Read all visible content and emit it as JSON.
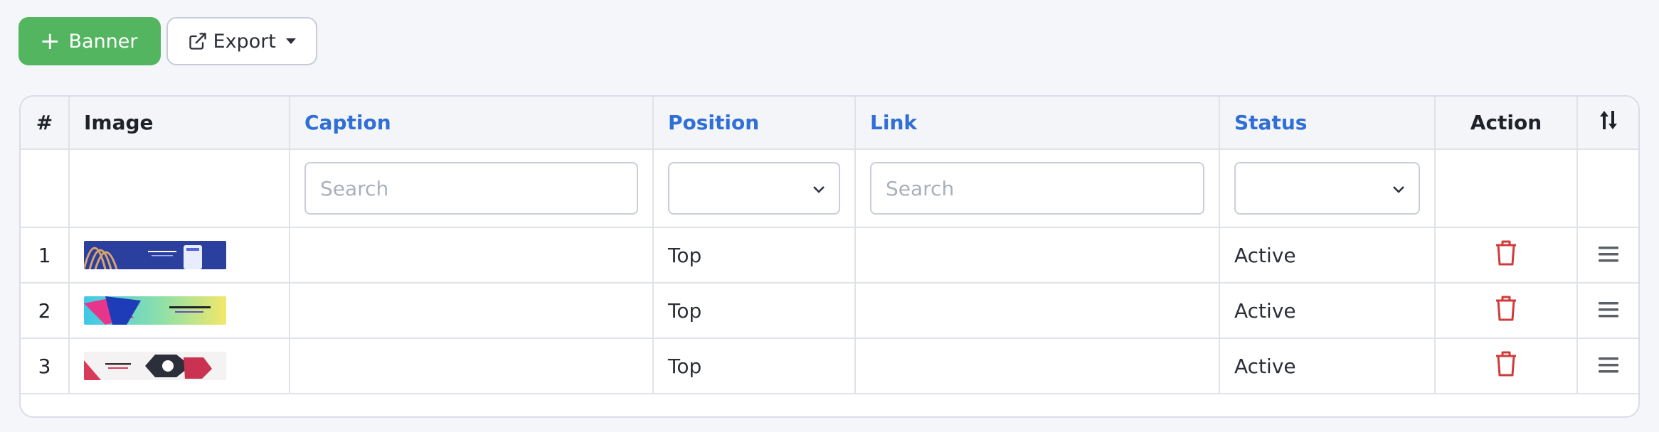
{
  "toolbar": {
    "add_label": "Banner",
    "export_label": "Export"
  },
  "table": {
    "headers": {
      "index": "#",
      "image": "Image",
      "caption": "Caption",
      "position": "Position",
      "link": "Link",
      "status": "Status",
      "action": "Action"
    },
    "filters": {
      "caption_placeholder": "Search",
      "link_placeholder": "Search",
      "position_value": "",
      "status_value": ""
    },
    "rows": [
      {
        "index": "1",
        "caption": "",
        "position": "Top",
        "link": "",
        "status": "Active"
      },
      {
        "index": "2",
        "caption": "",
        "position": "Top",
        "link": "",
        "status": "Active"
      },
      {
        "index": "3",
        "caption": "",
        "position": "Top",
        "link": "",
        "status": "Active"
      }
    ]
  },
  "colors": {
    "primary": "#53b560",
    "sortable_header": "#2f6fd6",
    "delete_icon": "#cf3b3b"
  },
  "icons": {
    "add": "plus-icon",
    "export": "external-link-icon",
    "sort": "sort-arrows-icon",
    "delete": "trash-icon",
    "drag": "drag-handle-icon"
  }
}
